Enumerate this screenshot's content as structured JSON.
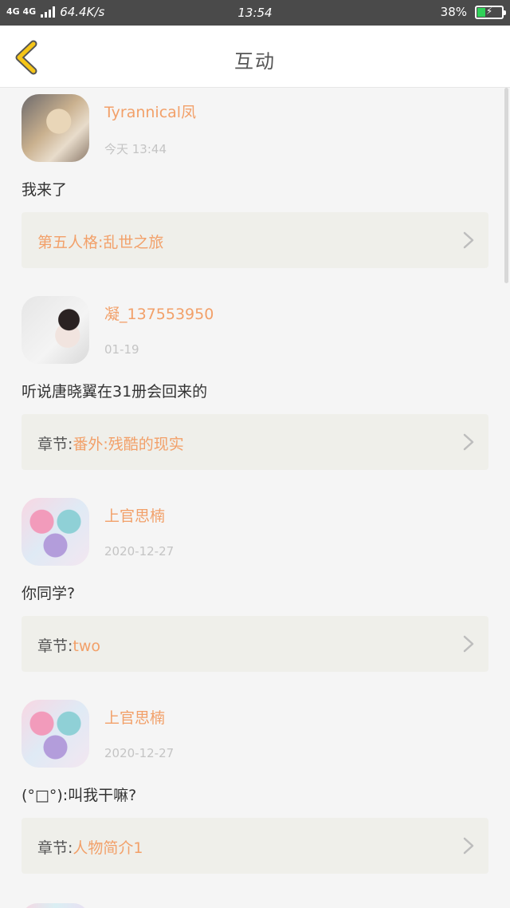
{
  "status_bar": {
    "network": "4G 4G",
    "speed": "64.4K/s",
    "time": "13:54",
    "battery_percent": "38%",
    "battery_level": 0.38
  },
  "header": {
    "title": "互动"
  },
  "items": [
    {
      "username": "Tyrannical凤",
      "date": "今天 13:44",
      "comment": "我来了",
      "chapter_prefix": "",
      "chapter_title": "第五人格:乱世之旅"
    },
    {
      "username": "凝_137553950",
      "date": "01-19",
      "comment": "听说唐晓翼在31册会回来的",
      "chapter_prefix": "章节:",
      "chapter_title": "番外:残酷的现实"
    },
    {
      "username": "上官思楠",
      "date": "2020-12-27",
      "comment": "你同学?",
      "chapter_prefix": "章节:",
      "chapter_title": "two"
    },
    {
      "username": "上官思楠",
      "date": "2020-12-27",
      "comment": "(°□°):叫我干嘛?",
      "chapter_prefix": "章节:",
      "chapter_title": "人物简介1"
    }
  ],
  "colors": {
    "accent": "#f2a069",
    "status_bar": "#4a4a4a",
    "back_arrow": "#f5c518",
    "chapter_bg": "#efefea"
  }
}
